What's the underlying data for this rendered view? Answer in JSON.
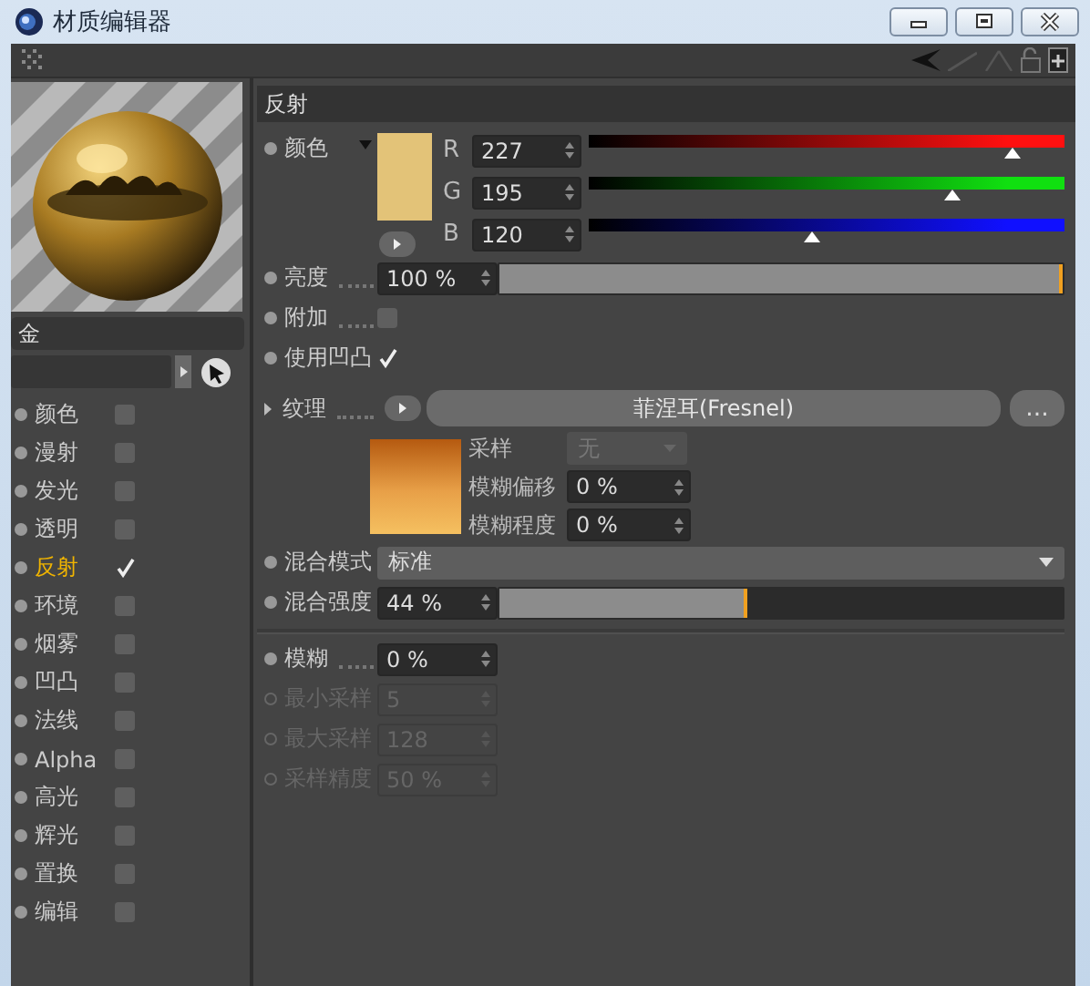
{
  "window": {
    "title": "材质编辑器"
  },
  "material": {
    "name": "金"
  },
  "channels": [
    {
      "label": "颜色",
      "checked": false,
      "selected": false
    },
    {
      "label": "漫射",
      "checked": false,
      "selected": false
    },
    {
      "label": "发光",
      "checked": false,
      "selected": false
    },
    {
      "label": "透明",
      "checked": false,
      "selected": false
    },
    {
      "label": "反射",
      "checked": true,
      "selected": true
    },
    {
      "label": "环境",
      "checked": false,
      "selected": false
    },
    {
      "label": "烟雾",
      "checked": false,
      "selected": false
    },
    {
      "label": "凹凸",
      "checked": false,
      "selected": false
    },
    {
      "label": "法线",
      "checked": false,
      "selected": false
    },
    {
      "label": "Alpha",
      "checked": false,
      "selected": false
    },
    {
      "label": "高光",
      "checked": false,
      "selected": false
    },
    {
      "label": "辉光",
      "checked": false,
      "selected": false
    },
    {
      "label": "置换",
      "checked": false,
      "selected": false
    },
    {
      "label": "编辑",
      "checked": false,
      "selected": false
    }
  ],
  "section": {
    "title": "反射"
  },
  "color": {
    "label": "颜色",
    "components": [
      {
        "label": "R",
        "value": "227",
        "level": 0.89,
        "color": "#ff1010"
      },
      {
        "label": "G",
        "value": "195",
        "level": 0.765,
        "color": "#10e010"
      },
      {
        "label": "B",
        "value": "120",
        "level": 0.47,
        "color": "#1010ff"
      }
    ]
  },
  "rows": [
    {
      "kind": "slider",
      "label": "亮度",
      "leader": true,
      "value": "100 %",
      "level": 1
    },
    {
      "kind": "checkbox",
      "label": "附加",
      "leader": true,
      "checked": false
    },
    {
      "kind": "checkbox",
      "label": "使用凹凸",
      "leader": false,
      "checked": true
    }
  ],
  "texture": {
    "label": "纹理",
    "shader": "菲涅耳(Fresnel)",
    "more": "...",
    "sampling": {
      "label": "采样",
      "value": "无",
      "disabled": true
    },
    "fields": [
      {
        "label": "模糊偏移",
        "value": "0 %"
      },
      {
        "label": "模糊程度",
        "value": "0 %"
      }
    ]
  },
  "blend_mode": {
    "label": "混合模式",
    "value": "标准"
  },
  "blend_strength": {
    "label": "混合强度",
    "value": "44 %",
    "level": 0.44
  },
  "blur_rows": [
    {
      "label": "模糊",
      "leader": true,
      "value": "0 %",
      "disabled": false
    },
    {
      "label": "最小采样",
      "leader": false,
      "value": "5",
      "disabled": true
    },
    {
      "label": "最大采样",
      "leader": false,
      "value": "128",
      "disabled": true
    },
    {
      "label": "采样精度",
      "leader": false,
      "value": "50 %",
      "disabled": true
    }
  ]
}
